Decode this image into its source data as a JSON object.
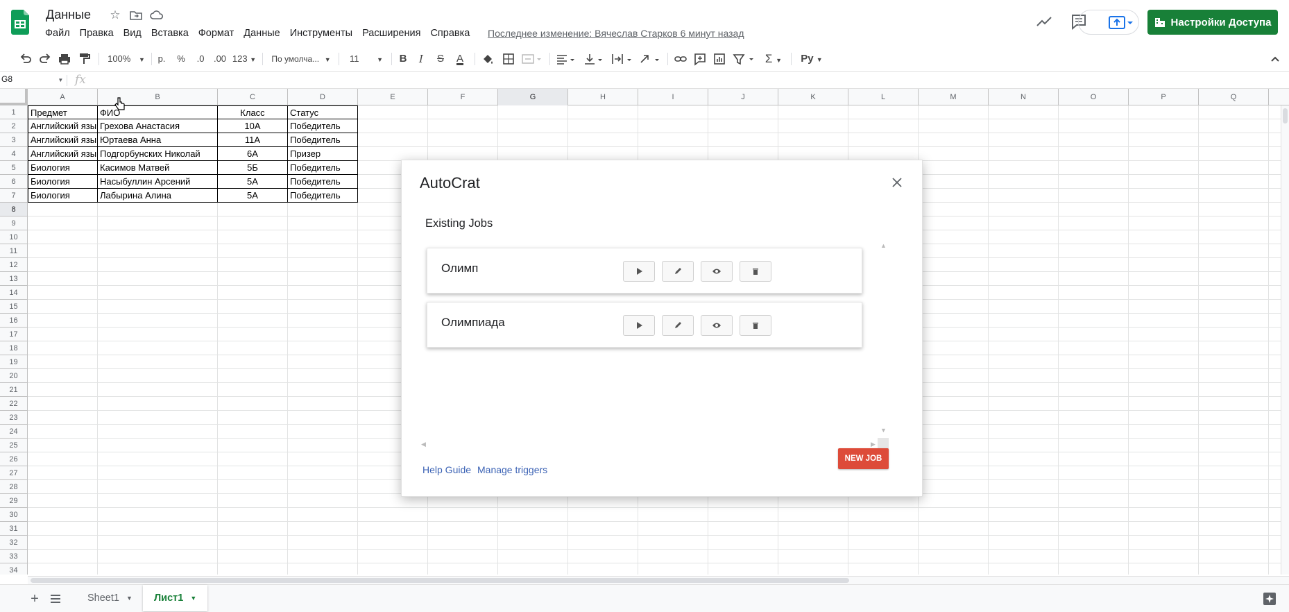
{
  "header": {
    "doc_title": "Данные",
    "menu": [
      "Файл",
      "Правка",
      "Вид",
      "Вставка",
      "Формат",
      "Данные",
      "Инструменты",
      "Расширения",
      "Справка"
    ],
    "last_edit": "Последнее изменение: Вячеслав Старков 6 минут назад",
    "share_label": "Настройки Доступа"
  },
  "toolbar": {
    "zoom": "100%",
    "currency": "р.",
    "percent": "%",
    "decimal_decrease": ".0",
    "decimal_increase": ".00",
    "format_more": "123",
    "font": "По умолча...",
    "font_size": "11",
    "bold": "B",
    "italic": "I",
    "strike": "S",
    "text_color": "A",
    "addon": "Рy"
  },
  "formula_bar": {
    "name_box": "G8",
    "fx": "fx",
    "value": ""
  },
  "grid": {
    "columns": [
      "A",
      "B",
      "C",
      "D",
      "E",
      "F",
      "G",
      "H",
      "I",
      "J",
      "K",
      "L",
      "M",
      "N",
      "O",
      "P",
      "Q"
    ],
    "selected_column": "G",
    "selected_row": 8,
    "row_count": 34,
    "headers": [
      "Предмет",
      "ФИО",
      "Класс",
      "Статус"
    ],
    "rows": [
      [
        "Английский язык",
        "Грехова Анастасия",
        "10А",
        "Победитель"
      ],
      [
        "Английский язык",
        "Юртаева Анна",
        "11А",
        "Победитель"
      ],
      [
        "Английский язык",
        "Подгорбунских Николай",
        "6А",
        "Призер"
      ],
      [
        "Биология",
        "Касимов Матвей",
        "5Б",
        "Победитель"
      ],
      [
        "Биология",
        "Насыбуллин Арсений",
        "5А",
        "Победитель"
      ],
      [
        "Биология",
        "Лабырина Алина",
        "5А",
        "Победитель"
      ]
    ]
  },
  "sheets": {
    "tabs": [
      "Sheet1",
      "Лист1"
    ],
    "active": "Лист1"
  },
  "dialog": {
    "title": "AutoCrat",
    "subtitle": "Existing Jobs",
    "jobs": [
      "Олимп",
      "Олимпиада"
    ],
    "new_job_label": "NEW JOB",
    "help_link": "Help Guide",
    "triggers_link": "Manage triggers"
  },
  "colors": {
    "share_green": "#188038",
    "new_job_red": "#dd4b39",
    "link_blue": "#3c63b5",
    "selection_blue": "#1a73e8"
  }
}
